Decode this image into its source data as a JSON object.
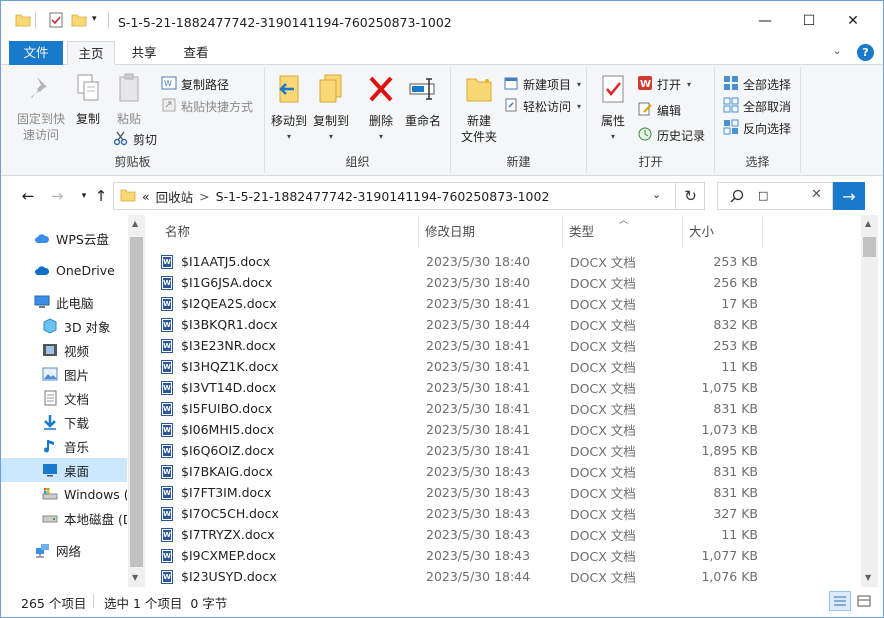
{
  "window": {
    "title": "S-1-5-21-1882477742-3190141194-760250873-1002",
    "controls": {
      "minimize": "—",
      "maximize": "☐",
      "close": "✕"
    }
  },
  "ribbon_tabs": [
    "文件",
    "主页",
    "共享",
    "查看"
  ],
  "ribbon": {
    "clipboard": {
      "label": "剪贴板",
      "pin": "固定到快\n速访问",
      "copy": "复制",
      "paste": "粘贴",
      "copy_path": "复制路径",
      "paste_shortcut": "粘贴快捷方式",
      "cut": "剪切"
    },
    "organize": {
      "label": "组织",
      "move_to": "移动到",
      "copy_to": "复制到",
      "delete": "删除",
      "rename": "重命名"
    },
    "new": {
      "label": "新建",
      "new_folder": "新建\n文件夹",
      "new_item": "新建项目",
      "easy_access": "轻松访问"
    },
    "open": {
      "label": "打开",
      "properties": "属性",
      "open": "打开",
      "edit": "编辑",
      "history": "历史记录"
    },
    "select": {
      "label": "选择",
      "select_all": "全部选择",
      "select_none": "全部取消",
      "invert": "反向选择"
    }
  },
  "address": {
    "prefix": "«",
    "segments": [
      "回收站",
      "S-1-5-21-1882477742-3190141194-760250873-1002"
    ],
    "separator": ">",
    "search_value": "□"
  },
  "nav_pane": [
    {
      "label": "WPS云盘",
      "icon": "cloud-icon"
    },
    {
      "label": "OneDrive",
      "icon": "onedrive-icon"
    },
    {
      "label": "此电脑",
      "icon": "computer-icon"
    },
    {
      "label": "3D 对象",
      "icon": "3d-objects-icon"
    },
    {
      "label": "视频",
      "icon": "video-icon"
    },
    {
      "label": "图片",
      "icon": "pictures-icon"
    },
    {
      "label": "文档",
      "icon": "documents-icon"
    },
    {
      "label": "下载",
      "icon": "downloads-icon"
    },
    {
      "label": "音乐",
      "icon": "music-icon"
    },
    {
      "label": "桌面",
      "icon": "desktop-icon",
      "selected": true
    },
    {
      "label": "Windows (C",
      "icon": "drive-c-icon"
    },
    {
      "label": "本地磁盘 (D",
      "icon": "drive-d-icon"
    },
    {
      "label": "网络",
      "icon": "network-icon"
    }
  ],
  "columns": {
    "name": "名称",
    "date": "修改日期",
    "type": "类型",
    "size": "大小"
  },
  "files": [
    {
      "name": "$I1AATJ5.docx",
      "date": "2023/5/30 18:40",
      "type": "DOCX 文档",
      "size": "253 KB"
    },
    {
      "name": "$I1G6JSA.docx",
      "date": "2023/5/30 18:40",
      "type": "DOCX 文档",
      "size": "256 KB"
    },
    {
      "name": "$I2QEA2S.docx",
      "date": "2023/5/30 18:41",
      "type": "DOCX 文档",
      "size": "17 KB"
    },
    {
      "name": "$I3BKQR1.docx",
      "date": "2023/5/30 18:44",
      "type": "DOCX 文档",
      "size": "832 KB"
    },
    {
      "name": "$I3E23NR.docx",
      "date": "2023/5/30 18:41",
      "type": "DOCX 文档",
      "size": "253 KB"
    },
    {
      "name": "$I3HQZ1K.docx",
      "date": "2023/5/30 18:41",
      "type": "DOCX 文档",
      "size": "11 KB"
    },
    {
      "name": "$I3VT14D.docx",
      "date": "2023/5/30 18:41",
      "type": "DOCX 文档",
      "size": "1,075 KB"
    },
    {
      "name": "$I5FUIBO.docx",
      "date": "2023/5/30 18:41",
      "type": "DOCX 文档",
      "size": "831 KB"
    },
    {
      "name": "$I06MHI5.docx",
      "date": "2023/5/30 18:41",
      "type": "DOCX 文档",
      "size": "1,073 KB"
    },
    {
      "name": "$I6Q6OIZ.docx",
      "date": "2023/5/30 18:41",
      "type": "DOCX 文档",
      "size": "1,895 KB"
    },
    {
      "name": "$I7BKAIG.docx",
      "date": "2023/5/30 18:43",
      "type": "DOCX 文档",
      "size": "831 KB"
    },
    {
      "name": "$I7FT3IM.docx",
      "date": "2023/5/30 18:43",
      "type": "DOCX 文档",
      "size": "831 KB"
    },
    {
      "name": "$I7OC5CH.docx",
      "date": "2023/5/30 18:43",
      "type": "DOCX 文档",
      "size": "327 KB"
    },
    {
      "name": "$I7TRYZX.docx",
      "date": "2023/5/30 18:43",
      "type": "DOCX 文档",
      "size": "11 KB"
    },
    {
      "name": "$I9CXMEP.docx",
      "date": "2023/5/30 18:43",
      "type": "DOCX 文档",
      "size": "1,077 KB"
    },
    {
      "name": "$I23USYD.docx",
      "date": "2023/5/30 18:44",
      "type": "DOCX 文档",
      "size": "1,076 KB"
    }
  ],
  "status": {
    "item_count": "265 个项目",
    "selection": "选中 1 个项目  0 字节"
  },
  "colors": {
    "accent": "#1979ca",
    "selected_bg": "#cce8ff",
    "ribbon_bg": "#f5f6f7"
  }
}
